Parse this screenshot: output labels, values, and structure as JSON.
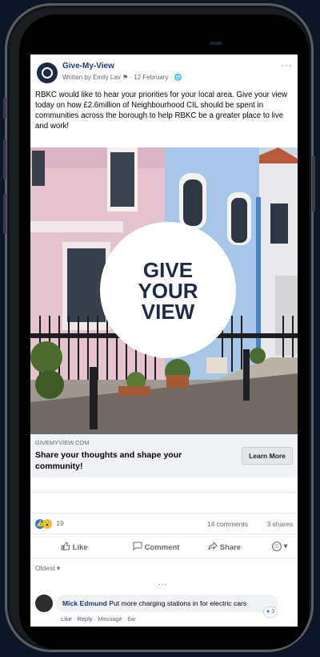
{
  "post": {
    "page_name": "Give-My-View",
    "meta": "Written by Emily Lav ⚑ · 12 February · 🌐",
    "more": "···",
    "text": "RBKC would like to hear your priorities for your local area. Give your view today on how £2.6million of Neighbourhood CIL should be spent in communities across the borough to help RBKC be a greater place to live and work!"
  },
  "image": {
    "badge_line1": "GIVE",
    "badge_line2": "YOUR",
    "badge_line3": "VIEW"
  },
  "link": {
    "domain": "GIVEMYVIEW.COM",
    "title": "Share your thoughts and shape your community!",
    "cta": "Learn More"
  },
  "reactions": {
    "count": "19",
    "comments": "14 comments",
    "shares": "3 shares"
  },
  "actions": {
    "like": "Like",
    "comment": "Comment",
    "share": "Share",
    "react_menu": "▾"
  },
  "comments": {
    "sort": "Oldest ▾",
    "more_dots": "...",
    "items": [
      {
        "author": "Mick Edmund",
        "text": "Put more charging stations in for electric cars",
        "like": "Like",
        "reply": "Reply",
        "message": "Message",
        "age": "6w",
        "reaction_count": "3"
      }
    ]
  },
  "colors": {
    "brand_navy": "#1d2a44",
    "link_blue": "#1b3a78",
    "like_blue": "#1877f2"
  }
}
